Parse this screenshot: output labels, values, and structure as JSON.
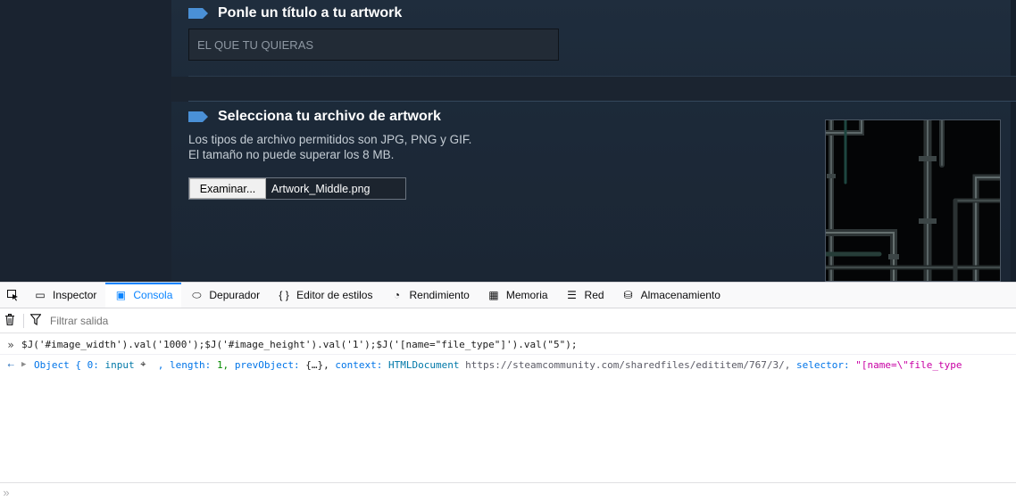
{
  "page": {
    "section_title": "Ponle un título a tu artwork",
    "title_placeholder": "EL QUE TU QUIERAS",
    "upload_title": "Selecciona tu archivo de artwork",
    "upload_desc_1": "Los tipos de archivo permitidos son JPG, PNG y GIF.",
    "upload_desc_2": "El tamaño no puede superar los 8 MB.",
    "browse_label": "Examinar...",
    "file_name": "Artwork_Middle.png",
    "accent_color": "#4a90d6"
  },
  "devtools": {
    "tabs": [
      {
        "label": "Inspector",
        "icon": "inspector-icon"
      },
      {
        "label": "Consola",
        "icon": "console-icon",
        "selected": true
      },
      {
        "label": "Depurador",
        "icon": "debugger-icon"
      },
      {
        "label": "Editor de estilos",
        "icon": "style-editor-icon"
      },
      {
        "label": "Rendimiento",
        "icon": "performance-icon"
      },
      {
        "label": "Memoria",
        "icon": "memory-icon"
      },
      {
        "label": "Red",
        "icon": "network-icon"
      },
      {
        "label": "Almacenamiento",
        "icon": "storage-icon"
      }
    ],
    "filter_placeholder": "Filtrar salida",
    "command": "$J('#image_width').val('1000');$J('#image_height').val('1');$J('[name=\"file_type\"]').val(\"5\");",
    "result": {
      "object_kw": "Object",
      "brace_open": "{",
      "k0": "0:",
      "v0": "input",
      "length_key": ", length:",
      "length_val": "1,",
      "prev_key": "prevObject:",
      "prev_val": "{…},",
      "context_key": "context:",
      "context_val": "HTMLDocument",
      "context_url": "https://steamcommunity.com/sharedfiles/edititem/767/3/,",
      "selector_key": "selector:",
      "selector_val": "\"[name=\\\"file_type"
    }
  }
}
